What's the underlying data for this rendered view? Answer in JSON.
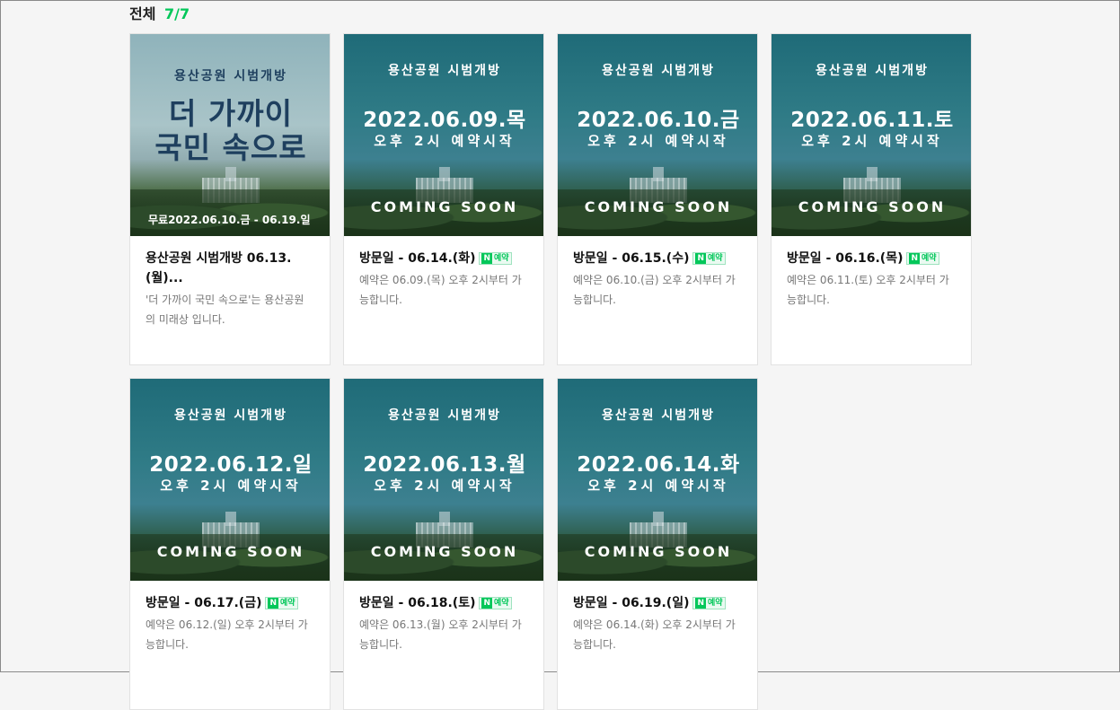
{
  "header": {
    "label": "전체",
    "count": "7/7"
  },
  "cards": [
    {
      "park": "용산공원 시범개방",
      "big1": "더 가까이",
      "big2": "국민 속으로",
      "free": "무료2022.06.10.금 - 06.19.일",
      "title": "용산공원 시범개방 06.13.(월)...",
      "desc": "'더 가까이 국민 속으로'는 용산공원의 미래상 입니다."
    },
    {
      "park": "용산공원 시범개방",
      "date": "2022.06.09.목",
      "time": "오후 2시 예약시작",
      "soon": "COMING SOON",
      "title": "방문일 - 06.14.(화)",
      "badge": "예약",
      "desc": "예약은 06.09.(목) 오후 2시부터 가능합니다."
    },
    {
      "park": "용산공원 시범개방",
      "date": "2022.06.10.금",
      "time": "오후 2시 예약시작",
      "soon": "COMING SOON",
      "title": "방문일 - 06.15.(수)",
      "badge": "예약",
      "desc": "예약은 06.10.(금) 오후 2시부터 가능합니다."
    },
    {
      "park": "용산공원 시범개방",
      "date": "2022.06.11.토",
      "time": "오후 2시 예약시작",
      "soon": "COMING SOON",
      "title": "방문일 - 06.16.(목)",
      "badge": "예약",
      "desc": "예약은 06.11.(토) 오후 2시부터 가능합니다."
    },
    {
      "park": "용산공원 시범개방",
      "date": "2022.06.12.일",
      "time": "오후 2시 예약시작",
      "soon": "COMING SOON",
      "title": "방문일 - 06.17.(금)",
      "badge": "예약",
      "desc": "예약은 06.12.(일) 오후 2시부터 가능합니다."
    },
    {
      "park": "용산공원 시범개방",
      "date": "2022.06.13.월",
      "time": "오후 2시 예약시작",
      "soon": "COMING SOON",
      "title": "방문일 - 06.18.(토)",
      "badge": "예약",
      "desc": "예약은 06.13.(월) 오후 2시부터 가능합니다."
    },
    {
      "park": "용산공원 시범개방",
      "date": "2022.06.14.화",
      "time": "오후 2시 예약시작",
      "soon": "COMING SOON",
      "title": "방문일 - 06.19.(일)",
      "badge": "예약",
      "desc": "예약은 06.14.(화) 오후 2시부터 가능합니다."
    }
  ],
  "badge_icon": "naver-n-icon",
  "colors": {
    "accent": "#03c75a",
    "thumb": "#2f7b86"
  }
}
